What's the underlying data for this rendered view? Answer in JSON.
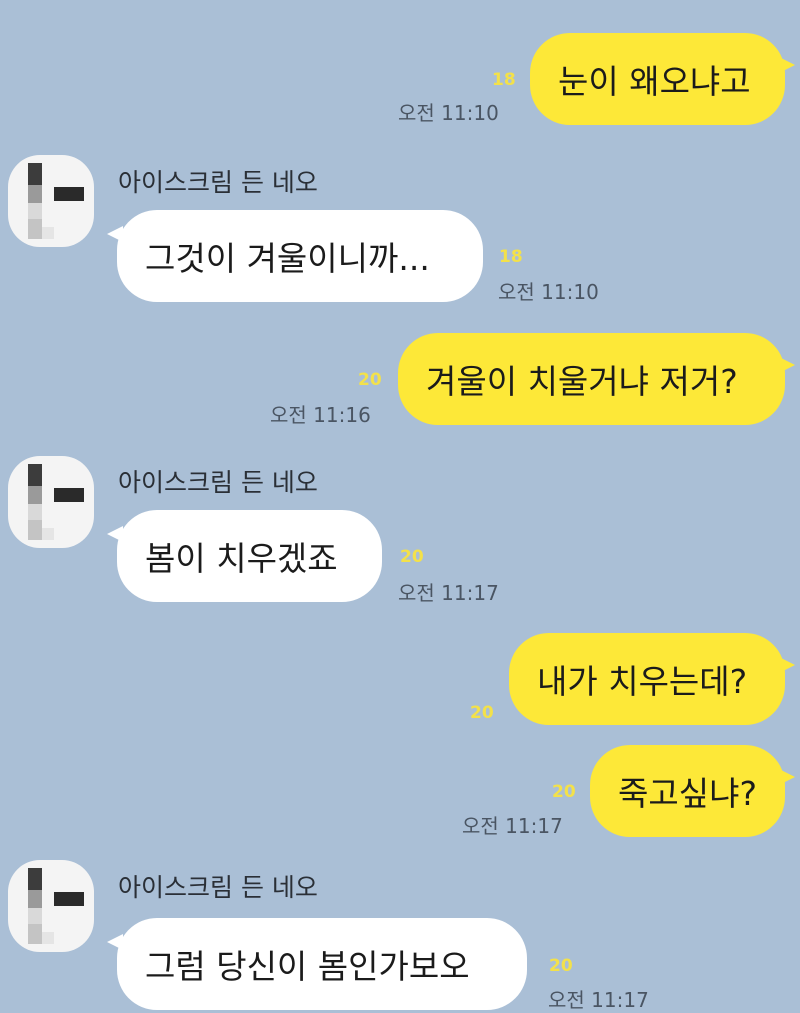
{
  "contact": {
    "name": "아이스크림 든 네오"
  },
  "messages": [
    {
      "id": "m1",
      "side": "me",
      "text": "눈이 왜오냐고",
      "unread": "18",
      "time": "오전 11:10"
    },
    {
      "id": "m2",
      "side": "them",
      "text": "그것이 겨울이니까...",
      "unread": "18",
      "time": "오전 11:10"
    },
    {
      "id": "m3",
      "side": "me",
      "text": "겨울이 치울거냐 저거?",
      "unread": "20",
      "time": "오전 11:16"
    },
    {
      "id": "m4",
      "side": "them",
      "text": "봄이 치우겠죠",
      "unread": "20",
      "time": "오전 11:17"
    },
    {
      "id": "m5",
      "side": "me",
      "text": "내가 치우는데?",
      "unread": "20",
      "time": ""
    },
    {
      "id": "m6",
      "side": "me",
      "text": "죽고싶냐?",
      "unread": "20",
      "time": "오전 11:17"
    },
    {
      "id": "m7",
      "side": "them",
      "text": "그럼 당신이 봄인가보오",
      "unread": "20",
      "time": "오전 11:17"
    }
  ]
}
